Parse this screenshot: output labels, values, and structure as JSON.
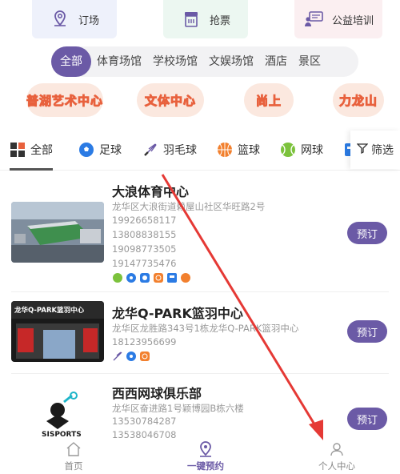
{
  "quick_actions": [
    {
      "label": "订场",
      "icon": "location-pin-icon"
    },
    {
      "label": "抢票",
      "icon": "ticket-icon"
    },
    {
      "label": "公益培训",
      "icon": "teacher-board-icon"
    }
  ],
  "venue_types": [
    "全部",
    "体育场馆",
    "学校场馆",
    "文娱场馆",
    "酒店",
    "景区"
  ],
  "venue_types_selected": "全部",
  "tags": [
    "普湖艺术中心",
    "文体中心",
    "尚上",
    "力龙山"
  ],
  "sport_tabs": [
    {
      "label": "全部",
      "icon": "grid-icon"
    },
    {
      "label": "足球",
      "icon": "soccer-ball-icon"
    },
    {
      "label": "羽毛球",
      "icon": "shuttlecock-icon"
    },
    {
      "label": "篮球",
      "icon": "basketball-icon"
    },
    {
      "label": "网球",
      "icon": "tennis-ball-icon"
    }
  ],
  "sport_tabs_selected": "全部",
  "filter_label": "筛选",
  "venues": [
    {
      "name": "大浪体育中心",
      "address": "龙华区大浪街道赖屋山社区华旺路2号",
      "phones": [
        "19926658117",
        "13808838155",
        "19098773505",
        "19147735476"
      ],
      "sport_icons": [
        "tennis-ball-icon",
        "soccer-ball-icon",
        "soccer-ball-icon",
        "basketball-icon",
        "badminton-icon",
        "basketball-icon"
      ],
      "book_label": "预订"
    },
    {
      "name": "龙华Q-PARK篮羽中心",
      "address": "龙华区龙胜路343号1栋龙华Q-PARK篮羽中心",
      "phones": [
        "18123956699"
      ],
      "thumb_text": "龙华Q-PARK篮羽中心",
      "sport_icons": [
        "shuttlecock-icon",
        "soccer-ball-icon",
        "basketball-icon"
      ],
      "book_label": "预订"
    },
    {
      "name": "西西网球俱乐部",
      "address": "龙华区奋进路1号颖博园B栋六楼",
      "phones": [
        "13530784287",
        "13538046708"
      ],
      "thumb_text": "SISPORTS",
      "book_label": "预订"
    }
  ],
  "bottom_nav": [
    {
      "label": "首页",
      "icon": "home-icon"
    },
    {
      "label": "一键预约",
      "icon": "location-pin-icon"
    },
    {
      "label": "个人中心",
      "icon": "user-icon"
    }
  ],
  "bottom_nav_selected": "一键预约",
  "colors": {
    "accent": "#6b5aa6",
    "tag_text": "#e8613d",
    "arrow": "#e53935"
  }
}
